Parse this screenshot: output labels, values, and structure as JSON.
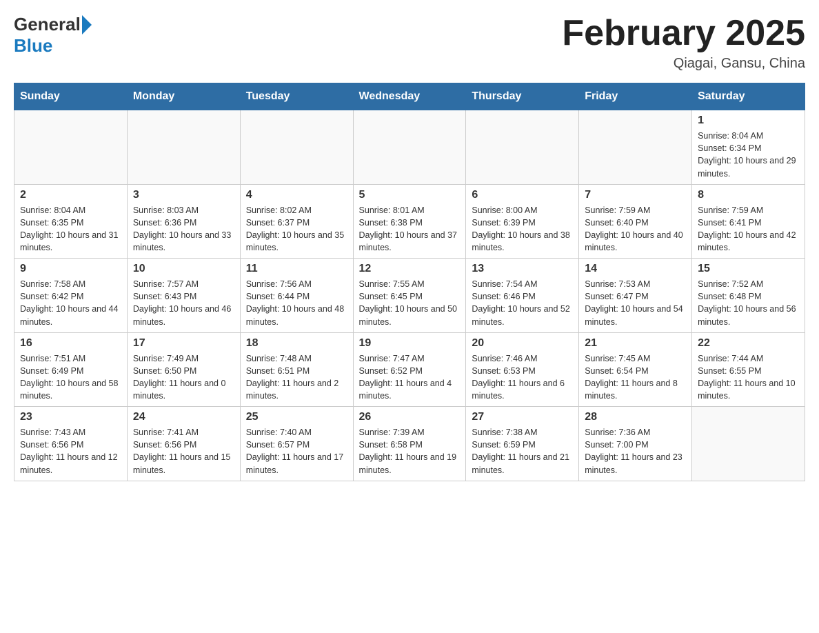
{
  "header": {
    "logo_general": "General",
    "logo_blue": "Blue",
    "month_title": "February 2025",
    "location": "Qiagai, Gansu, China"
  },
  "weekdays": [
    "Sunday",
    "Monday",
    "Tuesday",
    "Wednesday",
    "Thursday",
    "Friday",
    "Saturday"
  ],
  "weeks": [
    [
      {
        "day": "",
        "info": ""
      },
      {
        "day": "",
        "info": ""
      },
      {
        "day": "",
        "info": ""
      },
      {
        "day": "",
        "info": ""
      },
      {
        "day": "",
        "info": ""
      },
      {
        "day": "",
        "info": ""
      },
      {
        "day": "1",
        "info": "Sunrise: 8:04 AM\nSunset: 6:34 PM\nDaylight: 10 hours and 29 minutes."
      }
    ],
    [
      {
        "day": "2",
        "info": "Sunrise: 8:04 AM\nSunset: 6:35 PM\nDaylight: 10 hours and 31 minutes."
      },
      {
        "day": "3",
        "info": "Sunrise: 8:03 AM\nSunset: 6:36 PM\nDaylight: 10 hours and 33 minutes."
      },
      {
        "day": "4",
        "info": "Sunrise: 8:02 AM\nSunset: 6:37 PM\nDaylight: 10 hours and 35 minutes."
      },
      {
        "day": "5",
        "info": "Sunrise: 8:01 AM\nSunset: 6:38 PM\nDaylight: 10 hours and 37 minutes."
      },
      {
        "day": "6",
        "info": "Sunrise: 8:00 AM\nSunset: 6:39 PM\nDaylight: 10 hours and 38 minutes."
      },
      {
        "day": "7",
        "info": "Sunrise: 7:59 AM\nSunset: 6:40 PM\nDaylight: 10 hours and 40 minutes."
      },
      {
        "day": "8",
        "info": "Sunrise: 7:59 AM\nSunset: 6:41 PM\nDaylight: 10 hours and 42 minutes."
      }
    ],
    [
      {
        "day": "9",
        "info": "Sunrise: 7:58 AM\nSunset: 6:42 PM\nDaylight: 10 hours and 44 minutes."
      },
      {
        "day": "10",
        "info": "Sunrise: 7:57 AM\nSunset: 6:43 PM\nDaylight: 10 hours and 46 minutes."
      },
      {
        "day": "11",
        "info": "Sunrise: 7:56 AM\nSunset: 6:44 PM\nDaylight: 10 hours and 48 minutes."
      },
      {
        "day": "12",
        "info": "Sunrise: 7:55 AM\nSunset: 6:45 PM\nDaylight: 10 hours and 50 minutes."
      },
      {
        "day": "13",
        "info": "Sunrise: 7:54 AM\nSunset: 6:46 PM\nDaylight: 10 hours and 52 minutes."
      },
      {
        "day": "14",
        "info": "Sunrise: 7:53 AM\nSunset: 6:47 PM\nDaylight: 10 hours and 54 minutes."
      },
      {
        "day": "15",
        "info": "Sunrise: 7:52 AM\nSunset: 6:48 PM\nDaylight: 10 hours and 56 minutes."
      }
    ],
    [
      {
        "day": "16",
        "info": "Sunrise: 7:51 AM\nSunset: 6:49 PM\nDaylight: 10 hours and 58 minutes."
      },
      {
        "day": "17",
        "info": "Sunrise: 7:49 AM\nSunset: 6:50 PM\nDaylight: 11 hours and 0 minutes."
      },
      {
        "day": "18",
        "info": "Sunrise: 7:48 AM\nSunset: 6:51 PM\nDaylight: 11 hours and 2 minutes."
      },
      {
        "day": "19",
        "info": "Sunrise: 7:47 AM\nSunset: 6:52 PM\nDaylight: 11 hours and 4 minutes."
      },
      {
        "day": "20",
        "info": "Sunrise: 7:46 AM\nSunset: 6:53 PM\nDaylight: 11 hours and 6 minutes."
      },
      {
        "day": "21",
        "info": "Sunrise: 7:45 AM\nSunset: 6:54 PM\nDaylight: 11 hours and 8 minutes."
      },
      {
        "day": "22",
        "info": "Sunrise: 7:44 AM\nSunset: 6:55 PM\nDaylight: 11 hours and 10 minutes."
      }
    ],
    [
      {
        "day": "23",
        "info": "Sunrise: 7:43 AM\nSunset: 6:56 PM\nDaylight: 11 hours and 12 minutes."
      },
      {
        "day": "24",
        "info": "Sunrise: 7:41 AM\nSunset: 6:56 PM\nDaylight: 11 hours and 15 minutes."
      },
      {
        "day": "25",
        "info": "Sunrise: 7:40 AM\nSunset: 6:57 PM\nDaylight: 11 hours and 17 minutes."
      },
      {
        "day": "26",
        "info": "Sunrise: 7:39 AM\nSunset: 6:58 PM\nDaylight: 11 hours and 19 minutes."
      },
      {
        "day": "27",
        "info": "Sunrise: 7:38 AM\nSunset: 6:59 PM\nDaylight: 11 hours and 21 minutes."
      },
      {
        "day": "28",
        "info": "Sunrise: 7:36 AM\nSunset: 7:00 PM\nDaylight: 11 hours and 23 minutes."
      },
      {
        "day": "",
        "info": ""
      }
    ]
  ]
}
